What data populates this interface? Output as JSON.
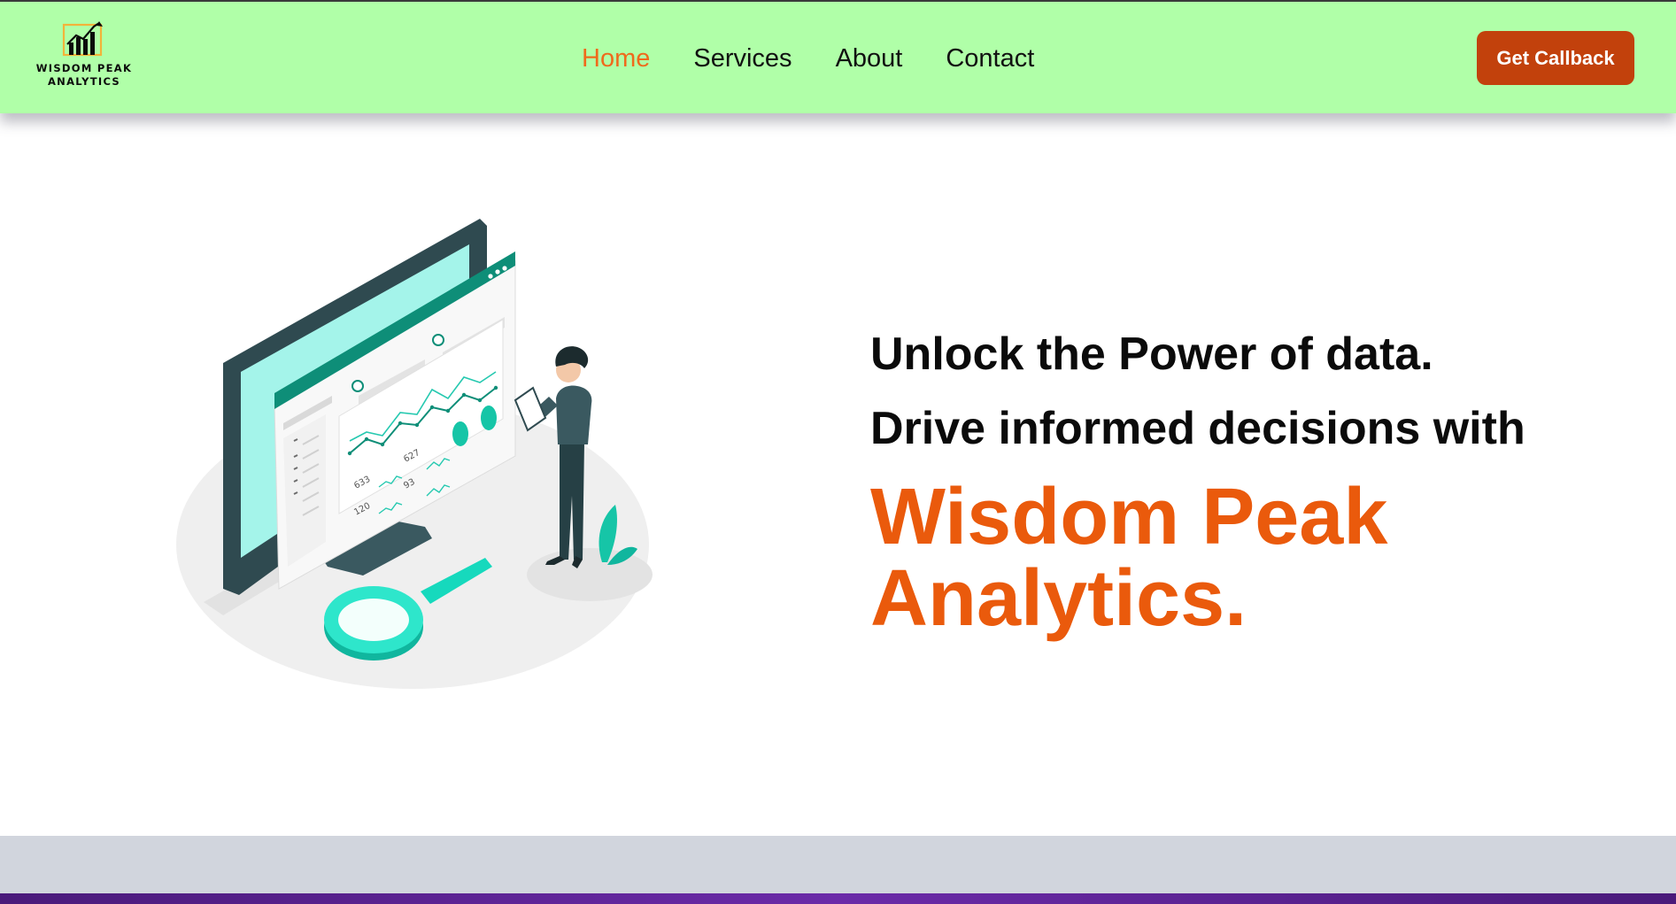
{
  "header": {
    "logo_text": "WISDOM PEAK ANALYTICS",
    "nav": [
      {
        "label": "Home",
        "active": true
      },
      {
        "label": "Services",
        "active": false
      },
      {
        "label": "About",
        "active": false
      },
      {
        "label": "Contact",
        "active": false
      }
    ],
    "cta_label": "Get Callback"
  },
  "hero": {
    "line1": "Unlock the Power of data.",
    "line2": "Drive informed decisions with",
    "brand": "Wisdom Peak Analytics.",
    "illustration": {
      "kpi_labels": [
        "627",
        "633",
        "93",
        "120"
      ]
    }
  },
  "colors": {
    "header_bg": "#b0ffa8",
    "nav_active": "#ef6a1c",
    "cta_bg": "#c2410c",
    "brand_text": "#ea5a0c",
    "accent_teal": "#16d9bd",
    "footer_band": "#d1d5dd",
    "footer_strip": "#5b2191"
  }
}
